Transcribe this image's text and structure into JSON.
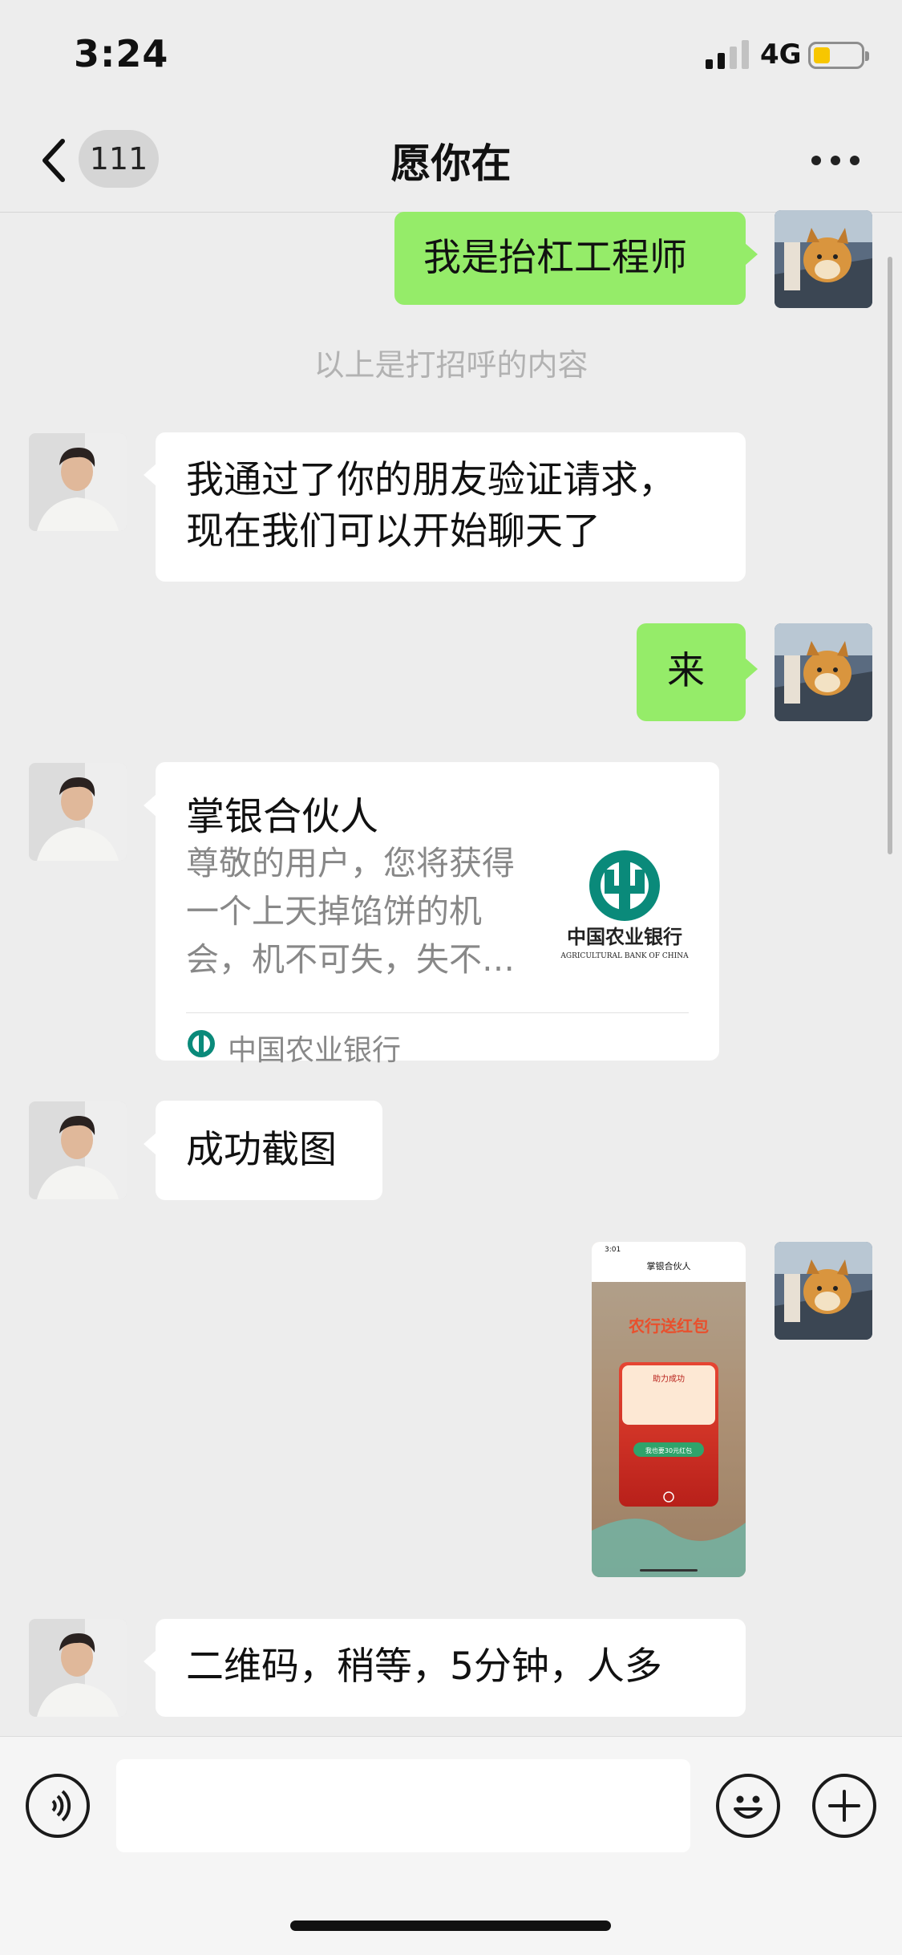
{
  "status": {
    "time": "3:24",
    "network": "4G"
  },
  "nav": {
    "back_badge": "111",
    "title": "愿你在",
    "more_icon": "more-dots-icon"
  },
  "messages": {
    "m1": "我是抬杠工程师",
    "system": "以上是打招呼的内容",
    "m2_line1": "我通过了你的朋友验证请求，",
    "m2_line2": "现在我们可以开始聊天了",
    "m3": "来",
    "m4_card": {
      "title": "掌银合伙人",
      "desc_line1": "尊敬的用户，您将获得",
      "desc_line2": "一个上天掉馅饼的机",
      "desc_line3": "会，机不可失，失不…",
      "logo_cn": "中国农业银行",
      "logo_en": "AGRICULTURAL BANK OF CHINA",
      "source": "中国农业银行"
    },
    "m5": "成功截图",
    "m6_image": {
      "time": "3:01",
      "title": "掌银合伙人",
      "banner": "农行送红包",
      "popup_title": "助力成功",
      "popup_button": "我也要30元红包"
    },
    "m7": "二维码，稍等，5分钟，人多"
  },
  "colors": {
    "my_bubble": "#95ec69",
    "other_bubble": "#ffffff",
    "bank_green": "#0a8a7a"
  }
}
